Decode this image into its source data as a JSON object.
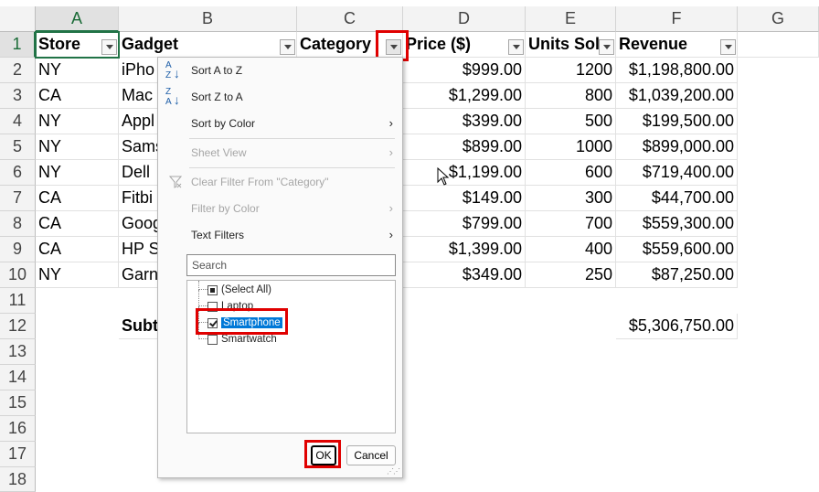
{
  "columns": [
    "A",
    "B",
    "C",
    "D",
    "E",
    "F",
    "G"
  ],
  "rows": [
    "1",
    "2",
    "3",
    "4",
    "5",
    "6",
    "7",
    "8",
    "9",
    "10",
    "11",
    "12",
    "13",
    "14",
    "15",
    "16",
    "17",
    "18"
  ],
  "headers": {
    "store": "Store",
    "gadget": "Gadget",
    "category": "Category",
    "price": "Price ($)",
    "units": "Units Sol",
    "revenue": "Revenue"
  },
  "data": [
    {
      "store": "NY",
      "gadget": "iPho",
      "price": "$999.00",
      "units": "1200",
      "revenue": "$1,198,800.00"
    },
    {
      "store": "CA",
      "gadget": "Mac",
      "price": "$1,299.00",
      "units": "800",
      "revenue": "$1,039,200.00"
    },
    {
      "store": "NY",
      "gadget": "Appl",
      "price": "$399.00",
      "units": "500",
      "revenue": "$199,500.00"
    },
    {
      "store": "NY",
      "gadget": "Sams",
      "price": "$899.00",
      "units": "1000",
      "revenue": "$899,000.00"
    },
    {
      "store": "NY",
      "gadget": "Dell",
      "price": "$1,199.00",
      "units": "600",
      "revenue": "$719,400.00"
    },
    {
      "store": "CA",
      "gadget": "Fitbi",
      "price": "$149.00",
      "units": "300",
      "revenue": "$44,700.00"
    },
    {
      "store": "CA",
      "gadget": "Goog",
      "price": "$799.00",
      "units": "700",
      "revenue": "$559,300.00"
    },
    {
      "store": "CA",
      "gadget": "HP S",
      "price": "$1,399.00",
      "units": "400",
      "revenue": "$559,600.00"
    },
    {
      "store": "NY",
      "gadget": "Garn",
      "price": "$349.00",
      "units": "250",
      "revenue": "$87,250.00"
    }
  ],
  "subtotal": {
    "label": "Subt",
    "revenue": "$5,306,750.00"
  },
  "menu": {
    "sort_az": "Sort A to Z",
    "sort_za": "Sort Z to A",
    "sort_color": "Sort by Color",
    "sheet_view": "Sheet View",
    "clear_filter": "Clear Filter From \"Category\"",
    "filter_color": "Filter by Color",
    "text_filters": "Text Filters",
    "search_placeholder": "Search",
    "items": [
      {
        "label": "(Select All)",
        "state": "partial"
      },
      {
        "label": "Laptop",
        "state": "unchecked"
      },
      {
        "label": "Smartphone",
        "state": "checked"
      },
      {
        "label": "Smartwatch",
        "state": "unchecked"
      }
    ],
    "ok": "OK",
    "cancel": "Cancel"
  },
  "accent_color": "#217346",
  "highlight_color": "#e00000"
}
